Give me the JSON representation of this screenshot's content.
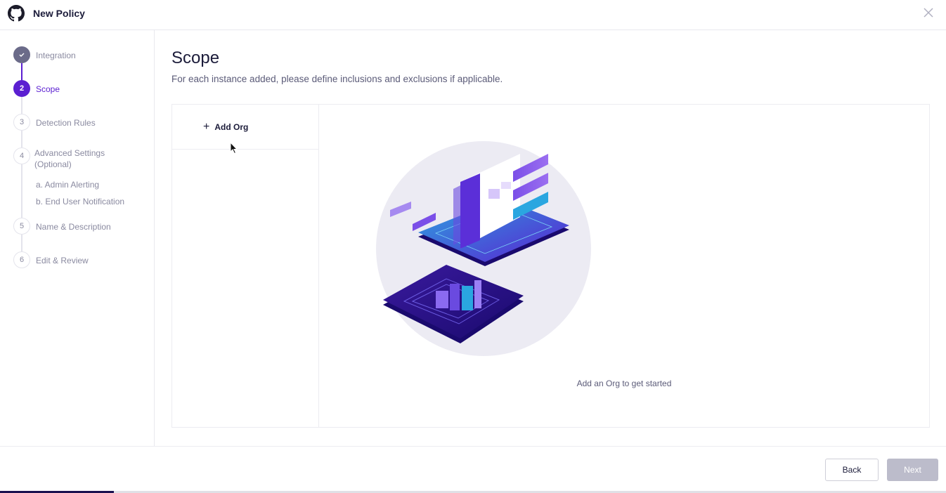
{
  "header": {
    "title": "New Policy",
    "logo_icon": "github-icon",
    "close_icon": "close-icon"
  },
  "steps": [
    {
      "number": "✓",
      "label": "Integration",
      "state": "done"
    },
    {
      "number": "2",
      "label": "Scope",
      "state": "active"
    },
    {
      "number": "3",
      "label": "Detection Rules",
      "state": "pending"
    },
    {
      "number": "4",
      "label": "Advanced Settings (Optional)",
      "state": "pending",
      "substeps": [
        "a. Admin Alerting",
        "b. End User Notification"
      ]
    },
    {
      "number": "5",
      "label": "Name & Description",
      "state": "pending"
    },
    {
      "number": "6",
      "label": "Edit & Review",
      "state": "pending"
    }
  ],
  "main": {
    "title": "Scope",
    "subtitle": "For each instance added, please define inclusions and exclusions if applicable.",
    "add_org_label": "Add Org",
    "empty_text": "Add an Org to get started"
  },
  "footer": {
    "back_label": "Back",
    "next_label": "Next",
    "progress": 0.12
  },
  "colors": {
    "accent": "#5b1fd1",
    "done": "#6b6b89",
    "muted": "#8a8aa0",
    "disabled": "#bcbccb"
  }
}
